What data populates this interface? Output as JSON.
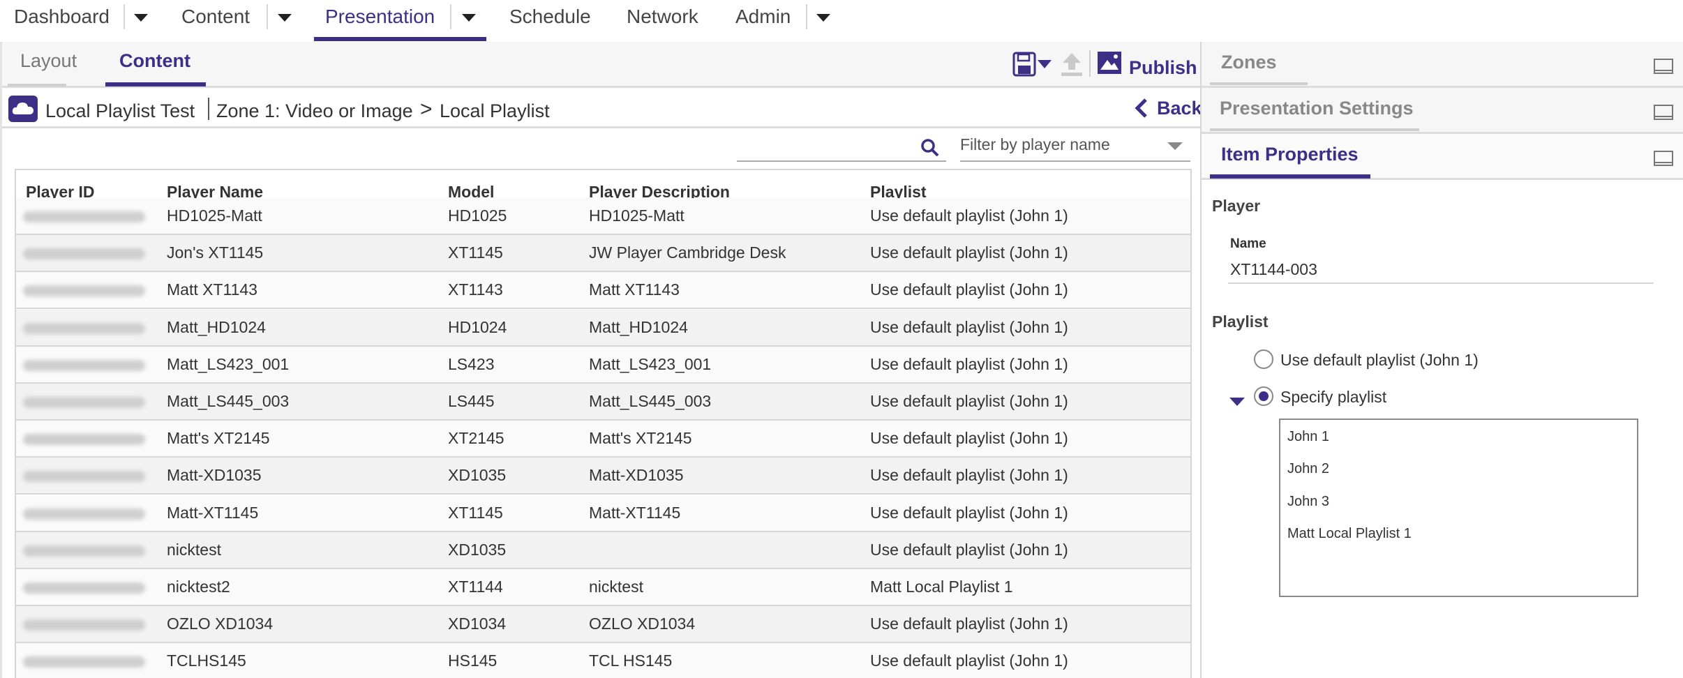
{
  "nav": {
    "items": [
      "Dashboard",
      "Content",
      "Presentation",
      "Schedule",
      "Network",
      "Admin"
    ],
    "active": "Presentation"
  },
  "subtabs": {
    "layout": "Layout",
    "content": "Content",
    "publish": "Publish"
  },
  "breadcrumb": {
    "presentation": "Local Playlist Test",
    "zone": "Zone 1: Video or Image",
    "separator": ">",
    "current": "Local Playlist",
    "back": "Back"
  },
  "filter": {
    "placeholder": "Filter by player name"
  },
  "table": {
    "columns": [
      "Player ID",
      "Player Name",
      "Model",
      "Player Description",
      "Playlist"
    ],
    "rows": [
      {
        "name": "HD1025-Matt",
        "model": "HD1025",
        "description": "HD1025-Matt",
        "playlist": "Use default playlist (John 1)"
      },
      {
        "name": "Jon's XT1145",
        "model": "XT1145",
        "description": "JW Player Cambridge Desk",
        "playlist": "Use default playlist (John 1)"
      },
      {
        "name": "Matt XT1143",
        "model": "XT1143",
        "description": "Matt XT1143",
        "playlist": "Use default playlist (John 1)"
      },
      {
        "name": "Matt_HD1024",
        "model": "HD1024",
        "description": "Matt_HD1024",
        "playlist": "Use default playlist (John 1)"
      },
      {
        "name": "Matt_LS423_001",
        "model": "LS423",
        "description": "Matt_LS423_001",
        "playlist": "Use default playlist (John 1)"
      },
      {
        "name": "Matt_LS445_003",
        "model": "LS445",
        "description": "Matt_LS445_003",
        "playlist": "Use default playlist (John 1)"
      },
      {
        "name": "Matt's XT2145",
        "model": "XT2145",
        "description": "Matt's XT2145",
        "playlist": "Use default playlist (John 1)"
      },
      {
        "name": "Matt-XD1035",
        "model": "XD1035",
        "description": "Matt-XD1035",
        "playlist": "Use default playlist (John 1)"
      },
      {
        "name": "Matt-XT1145",
        "model": "XT1145",
        "description": "Matt-XT1145",
        "playlist": "Use default playlist (John 1)"
      },
      {
        "name": "nicktest",
        "model": "XD1035",
        "description": "",
        "playlist": "Use default playlist (John 1)"
      },
      {
        "name": "nicktest2",
        "model": "XT1144",
        "description": "nicktest",
        "playlist": "Matt Local Playlist 1"
      },
      {
        "name": "OZLO XD1034",
        "model": "XD1034",
        "description": "OZLO XD1034",
        "playlist": "Use default playlist (John 1)"
      },
      {
        "name": "TCLHS145",
        "model": "HS145",
        "description": "TCL HS145",
        "playlist": "Use default playlist (John 1)"
      }
    ]
  },
  "right": {
    "zones": "Zones",
    "presentation_settings": "Presentation Settings",
    "item_properties": "Item Properties",
    "player_heading": "Player",
    "name_label": "Name",
    "name_value": "XT1144-003",
    "playlist_heading": "Playlist",
    "option_default": "Use default playlist (John 1)",
    "option_specify": "Specify playlist",
    "playlists": [
      "John 1",
      "John 2",
      "John 3",
      "Matt Local Playlist 1"
    ]
  },
  "colors": {
    "accent": "#3d2f86"
  }
}
